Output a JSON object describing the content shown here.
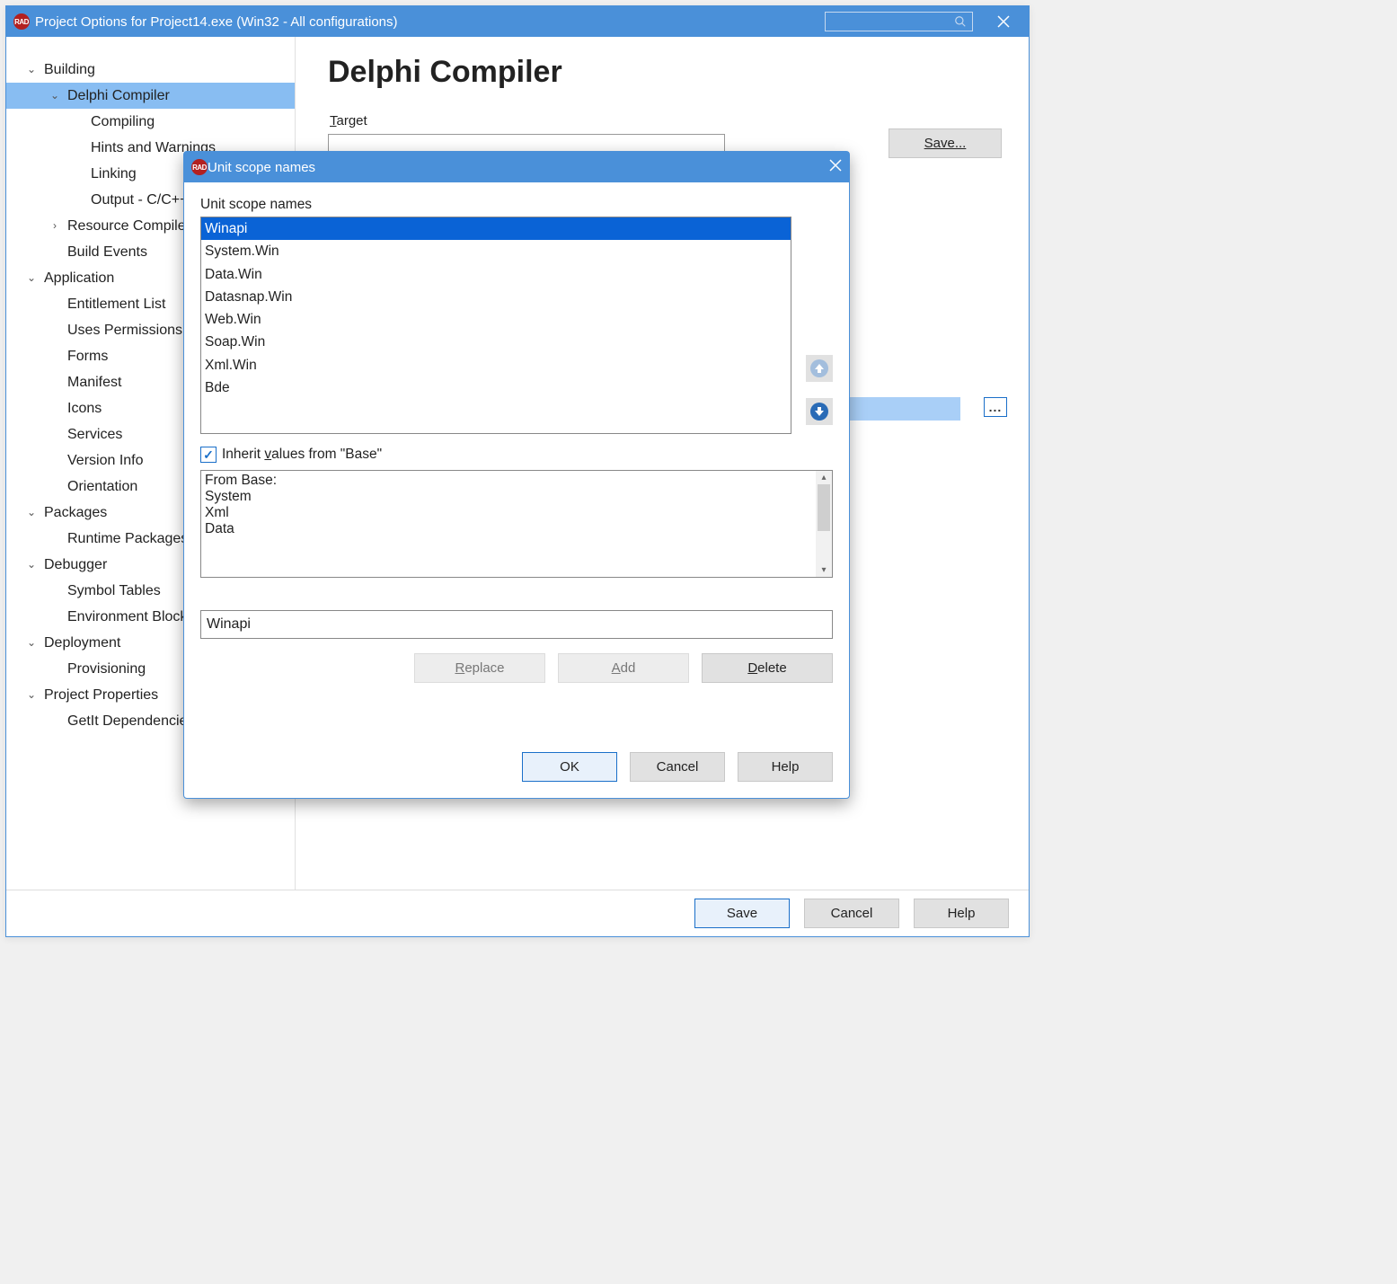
{
  "window": {
    "title": "Project Options for Project14.exe  (Win32 - All configurations)"
  },
  "sidebar": {
    "items": [
      {
        "label": "Building",
        "level": 1,
        "exp": "down"
      },
      {
        "label": "Delphi Compiler",
        "level": 2,
        "exp": "down",
        "selected": true
      },
      {
        "label": "Compiling",
        "level": 3,
        "exp": "none"
      },
      {
        "label": "Hints and Warnings",
        "level": 3,
        "exp": "none"
      },
      {
        "label": "Linking",
        "level": 3,
        "exp": "none"
      },
      {
        "label": "Output - C/C++",
        "level": 3,
        "exp": "none"
      },
      {
        "label": "Resource Compiler",
        "level": 2,
        "exp": "right"
      },
      {
        "label": "Build Events",
        "level": 2,
        "exp": "none"
      },
      {
        "label": "Application",
        "level": 1,
        "exp": "down"
      },
      {
        "label": "Entitlement List",
        "level": 2,
        "exp": "none"
      },
      {
        "label": "Uses Permissions",
        "level": 2,
        "exp": "none"
      },
      {
        "label": "Forms",
        "level": 2,
        "exp": "none"
      },
      {
        "label": "Manifest",
        "level": 2,
        "exp": "none"
      },
      {
        "label": "Icons",
        "level": 2,
        "exp": "none"
      },
      {
        "label": "Services",
        "level": 2,
        "exp": "none"
      },
      {
        "label": "Version Info",
        "level": 2,
        "exp": "none"
      },
      {
        "label": "Orientation",
        "level": 2,
        "exp": "none"
      },
      {
        "label": "Packages",
        "level": 1,
        "exp": "down"
      },
      {
        "label": "Runtime Packages",
        "level": 2,
        "exp": "none"
      },
      {
        "label": "Debugger",
        "level": 1,
        "exp": "down"
      },
      {
        "label": "Symbol Tables",
        "level": 2,
        "exp": "none"
      },
      {
        "label": "Environment Block",
        "level": 2,
        "exp": "none"
      },
      {
        "label": "Deployment",
        "level": 1,
        "exp": "down"
      },
      {
        "label": "Provisioning",
        "level": 2,
        "exp": "none"
      },
      {
        "label": "Project Properties",
        "level": 1,
        "exp": "down"
      },
      {
        "label": "GetIt Dependencies",
        "level": 2,
        "exp": "none"
      }
    ]
  },
  "content": {
    "heading": "Delphi Compiler",
    "target_label_pre": "T",
    "target_label_post": "arget",
    "save_label": "Save...",
    "browse_label": "..."
  },
  "footer": {
    "save": "Save",
    "cancel": "Cancel",
    "help": "Help"
  },
  "dialog": {
    "title": "Unit scope names",
    "label": "Unit scope names",
    "items": [
      "Winapi",
      "System.Win",
      "Data.Win",
      "Datasnap.Win",
      "Web.Win",
      "Soap.Win",
      "Xml.Win",
      "Bde"
    ],
    "selected_index": 0,
    "inherit_label_pre": "Inherit ",
    "inherit_label_u": "v",
    "inherit_label_post": "alues from \"Base\"",
    "base_header": "From Base:",
    "base_items": [
      "System",
      "Xml",
      "Data"
    ],
    "input_value": "Winapi",
    "buttons": {
      "replace": "Replace",
      "add": "Add",
      "delete": "Delete",
      "ok": "OK",
      "cancel": "Cancel",
      "help": "Help"
    }
  }
}
